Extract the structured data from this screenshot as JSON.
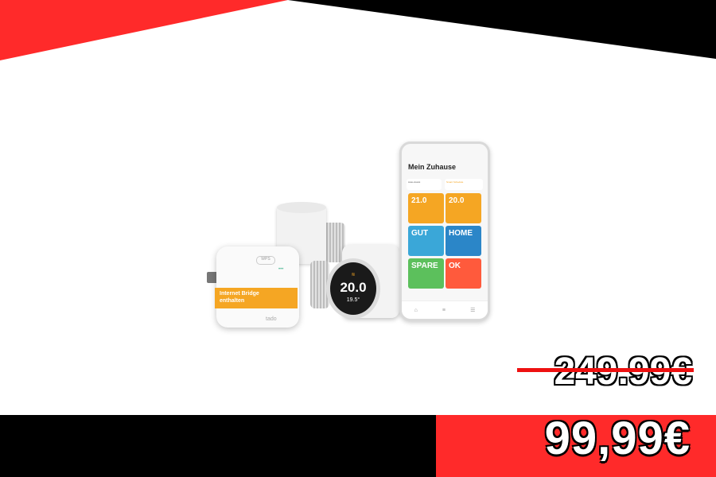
{
  "colors": {
    "accent_red": "#ff2a2a",
    "black": "#000000",
    "strike": "#e11111"
  },
  "pricing": {
    "old_price": "249.99€",
    "new_price": "99,99€"
  },
  "product": {
    "phone": {
      "title": "Mein Zuhause",
      "chips": [
        "Auto-Assist",
        "Smart Schedule"
      ],
      "tiles": [
        {
          "value": "21.0",
          "color": "#f5a623"
        },
        {
          "value": "20.0",
          "color": "#f5a623"
        },
        {
          "value": "GUT",
          "color": "#3aa7d8"
        },
        {
          "value": "HOME",
          "color": "#2b86c8"
        },
        {
          "value": "SPARE",
          "color": "#5cc05c"
        },
        {
          "value": "OK",
          "color": "#ff5a3c"
        }
      ],
      "nav_icons": [
        "home-icon",
        "list-icon",
        "menu-icon"
      ]
    },
    "bridge": {
      "label_line1": "Internet Bridge",
      "label_line2": "enthalten",
      "brand": "tado"
    },
    "thermostat": {
      "temperature": "20.0",
      "current": "19.5°"
    }
  }
}
